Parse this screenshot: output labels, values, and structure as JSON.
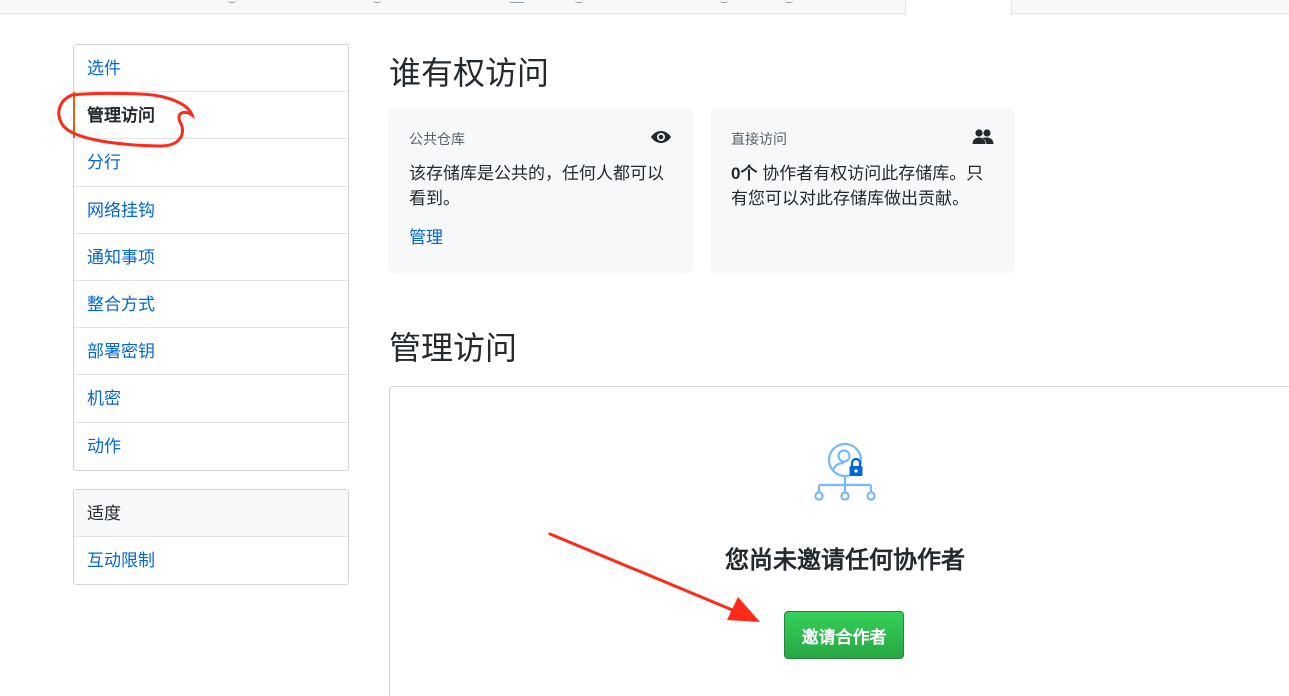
{
  "sidebar": {
    "items": [
      {
        "label": "选件",
        "selected": false
      },
      {
        "label": "管理访问",
        "selected": true
      },
      {
        "label": "分行",
        "selected": false
      },
      {
        "label": "网络挂钩",
        "selected": false
      },
      {
        "label": "通知事项",
        "selected": false
      },
      {
        "label": "整合方式",
        "selected": false
      },
      {
        "label": "部署密钥",
        "selected": false
      },
      {
        "label": "机密",
        "selected": false
      },
      {
        "label": "动作",
        "selected": false
      }
    ],
    "moderation": {
      "heading": "适度",
      "items": [
        {
          "label": "互动限制"
        }
      ]
    }
  },
  "main": {
    "who_heading": "谁有权访问",
    "public_card": {
      "title": "公共仓库",
      "icon": "eye-icon",
      "body": "该存储库是公共的，任何人都可以看到。",
      "link": "管理"
    },
    "direct_card": {
      "title": "直接访问",
      "icon": "people-icon",
      "count": "0个",
      "body": " 协作者有权访问此存储库。只有您可以对此存储库做出贡献。"
    },
    "manage_heading": "管理访问",
    "blankslate": {
      "icon": "person-lock-network-icon",
      "title": "您尚未邀请任何协作者",
      "button": "邀请合作者"
    }
  },
  "colors": {
    "link": "#0366d6",
    "button_green": "#28a745",
    "selected_bar": "#e36209",
    "annotation_red": "#ff2a1a"
  }
}
